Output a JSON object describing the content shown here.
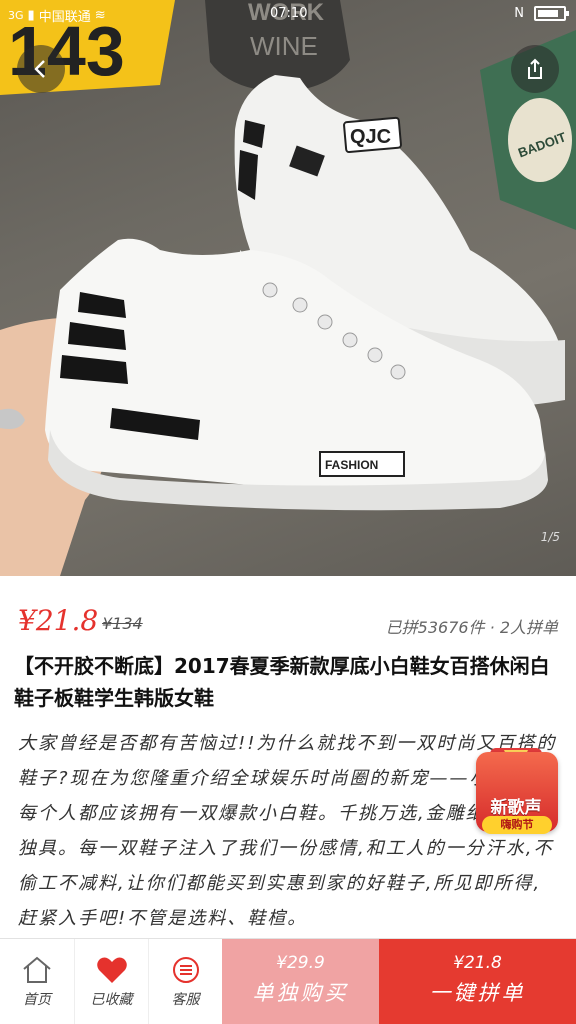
{
  "status_bar": {
    "network": "3G",
    "carrier": "中国联通",
    "time": "07:10",
    "nfc": "N"
  },
  "product": {
    "image_index": "1/5",
    "box_text_top": "WORK",
    "box_text_bottom": "WINE",
    "plate_number": "143",
    "tongue_label": "QJC",
    "side_label": "FASHION",
    "bottle_label": "BADOIT",
    "price": "¥21.8",
    "original_price": "¥134",
    "sold_info": "已拼53676件 · 2人拼单",
    "title": "【不开胶不断底】2017春夏季新款厚底小白鞋女百搭休闲白鞋子板鞋学生韩版女鞋",
    "description": "大家曾经是否都有苦恼过!!为什么就找不到一双时尚又百搭的鞋子?现在为您隆重介绍全球娱乐时尚圈的新宠——小白鞋❗每个人都应该拥有一双爆款小白鞋。千挑万选,金雕细刻,匠心独具。每一双鞋子注入了我们一份感情,和工人的一分汗水,不偷工不减料,让你们都能买到实惠到家的好鞋子,所见即所得,赶紧入手吧!不管是选料、鞋楦。"
  },
  "promo": {
    "title": "新歌声",
    "subtitle": "嗨购节"
  },
  "bottom_bar": {
    "home_label": "首页",
    "fav_label": "已收藏",
    "cs_label": "客服",
    "single_price": "¥29.9",
    "single_label": "单独购买",
    "group_price": "¥21.8",
    "group_label": "一键拼单"
  },
  "colors": {
    "accent": "#e53a30",
    "accent_light": "#f0a3a3",
    "price": "#e5322d"
  }
}
